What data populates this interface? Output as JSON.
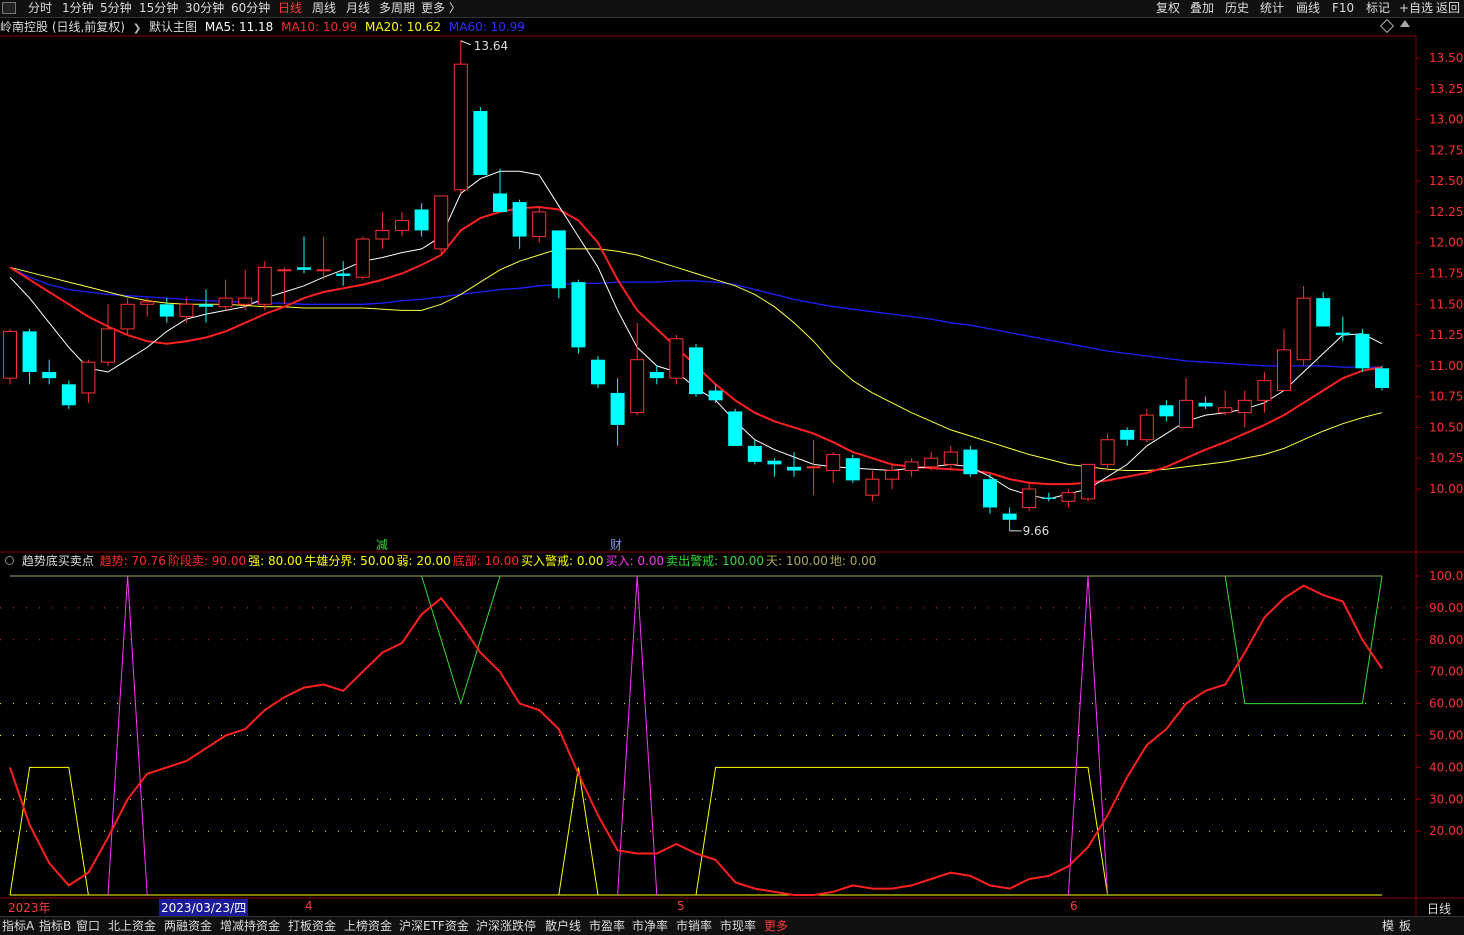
{
  "topbar": {
    "tabs": [
      {
        "label": "分时",
        "active": false
      },
      {
        "label": "1分钟",
        "active": false
      },
      {
        "label": "5分钟",
        "active": false
      },
      {
        "label": "15分钟",
        "active": false
      },
      {
        "label": "30分钟",
        "active": false
      },
      {
        "label": "60分钟",
        "active": false
      },
      {
        "label": "日线",
        "active": true
      },
      {
        "label": "周线",
        "active": false
      },
      {
        "label": "月线",
        "active": false
      },
      {
        "label": "多周期",
        "active": false
      },
      {
        "label": "更多 〉",
        "active": false
      }
    ],
    "tools": [
      "复权",
      "叠加",
      "历史",
      "统计",
      "画线",
      "F10",
      "标记",
      "+自选",
      "返回"
    ]
  },
  "main_chart": {
    "stock_title": "岭南控股 (日线,前复权)",
    "chevron": "❯",
    "template": "默认主图",
    "ma": [
      {
        "label": "MA5: 11.18",
        "color": "#ffffff"
      },
      {
        "label": "MA10: 10.99",
        "color": "#ff2a2a"
      },
      {
        "label": "MA20: 10.62",
        "color": "#ffff00"
      },
      {
        "label": "MA60: 10.99",
        "color": "#2f2fff"
      }
    ],
    "high_label": "13.64",
    "low_label": "9.66",
    "marker_1": "减",
    "marker_2": "财"
  },
  "indicator": {
    "name": "趋势底买卖点",
    "params": [
      {
        "label": "趋势: 70.76",
        "color": "#ff2a2a"
      },
      {
        "label": "阶段卖: 90.00",
        "color": "#ff2a2a"
      },
      {
        "label": "强: 80.00",
        "color": "#ffff00"
      },
      {
        "label": "牛雄分界: 50.00",
        "color": "#ffff00"
      },
      {
        "label": "弱: 20.00",
        "color": "#ffff00"
      },
      {
        "label": "底部: 10.00",
        "color": "#ff2a2a"
      },
      {
        "label": "买入警戒: 0.00",
        "color": "#ffff00"
      },
      {
        "label": "买入: 0.00",
        "color": "#ff33ff"
      },
      {
        "label": "卖出警戒: 100.00",
        "color": "#33dd33"
      },
      {
        "label": "天: 100.00",
        "color": "#aaaa55"
      },
      {
        "label": "地: 0.00",
        "color": "#aaaa55"
      }
    ]
  },
  "price_axis": [
    "13.50",
    "13.25",
    "13.00",
    "12.75",
    "12.50",
    "12.25",
    "12.00",
    "11.75",
    "11.50",
    "11.25",
    "11.00",
    "10.75",
    "10.50",
    "10.25",
    "10.00"
  ],
  "indicator_axis": [
    "100.0",
    "90.00",
    "80.00",
    "70.00",
    "60.00",
    "50.00",
    "40.00",
    "30.00",
    "20.00"
  ],
  "date_axis": {
    "year": "2023年",
    "cursor_date": "2023/03/23/四",
    "months": [
      "4",
      "5",
      "6"
    ],
    "period": "日线"
  },
  "bottombar": {
    "tabs": [
      "指标A",
      "指标B",
      "窗口",
      "北上资金",
      "两融资金",
      "增减持资金",
      "打板资金",
      "上榜资金",
      "沪深ETF资金",
      "沪深涨跌停",
      "散户线",
      "市盈率",
      "市净率",
      "市销率",
      "市现率",
      "更多"
    ],
    "right": [
      "模",
      "板"
    ]
  },
  "colors": {
    "up": "#ff3030",
    "down": "#00ffff",
    "ma5": "#ffffff",
    "ma10": "#ff2020",
    "ma20": "#ffff40",
    "ma60": "#2020ff",
    "trend": "#ff2020"
  },
  "chart_data": {
    "type": "candlestick",
    "ylim": [
      9.55,
      13.75
    ],
    "candles": [
      {
        "o": 10.9,
        "h": 11.3,
        "l": 10.85,
        "c": 11.28
      },
      {
        "o": 11.28,
        "h": 11.3,
        "l": 10.85,
        "c": 10.95
      },
      {
        "o": 10.95,
        "h": 11.05,
        "l": 10.85,
        "c": 10.9
      },
      {
        "o": 10.85,
        "h": 10.88,
        "l": 10.65,
        "c": 10.68
      },
      {
        "o": 10.78,
        "h": 11.05,
        "l": 10.7,
        "c": 11.03
      },
      {
        "o": 11.03,
        "h": 11.5,
        "l": 11.0,
        "c": 11.3
      },
      {
        "o": 11.3,
        "h": 11.55,
        "l": 11.25,
        "c": 11.5
      },
      {
        "o": 11.5,
        "h": 11.55,
        "l": 11.4,
        "c": 11.52
      },
      {
        "o": 11.5,
        "h": 11.55,
        "l": 11.35,
        "c": 11.4
      },
      {
        "o": 11.4,
        "h": 11.55,
        "l": 11.35,
        "c": 11.5
      },
      {
        "o": 11.5,
        "h": 11.62,
        "l": 11.35,
        "c": 11.48
      },
      {
        "o": 11.48,
        "h": 11.7,
        "l": 11.45,
        "c": 11.55
      },
      {
        "o": 11.5,
        "h": 11.78,
        "l": 11.45,
        "c": 11.55
      },
      {
        "o": 11.5,
        "h": 11.85,
        "l": 11.45,
        "c": 11.8
      },
      {
        "o": 11.78,
        "h": 11.8,
        "l": 11.5,
        "c": 11.78
      },
      {
        "o": 11.8,
        "h": 12.05,
        "l": 11.75,
        "c": 11.78
      },
      {
        "o": 11.78,
        "h": 12.05,
        "l": 11.7,
        "c": 11.78
      },
      {
        "o": 11.75,
        "h": 11.85,
        "l": 11.65,
        "c": 11.73
      },
      {
        "o": 11.72,
        "h": 12.05,
        "l": 11.7,
        "c": 12.03
      },
      {
        "o": 12.03,
        "h": 12.25,
        "l": 11.95,
        "c": 12.1
      },
      {
        "o": 12.1,
        "h": 12.25,
        "l": 12.05,
        "c": 12.18
      },
      {
        "o": 12.27,
        "h": 12.32,
        "l": 12.05,
        "c": 12.1
      },
      {
        "o": 11.95,
        "h": 12.3,
        "l": 11.9,
        "c": 12.38
      },
      {
        "o": 12.43,
        "h": 13.64,
        "l": 12.4,
        "c": 13.45
      },
      {
        "o": 13.07,
        "h": 13.1,
        "l": 12.55,
        "c": 12.55
      },
      {
        "o": 12.4,
        "h": 12.6,
        "l": 12.25,
        "c": 12.25
      },
      {
        "o": 12.33,
        "h": 12.35,
        "l": 11.95,
        "c": 12.05
      },
      {
        "o": 12.05,
        "h": 12.3,
        "l": 12.0,
        "c": 12.25
      },
      {
        "o": 12.1,
        "h": 12.1,
        "l": 11.55,
        "c": 11.63
      },
      {
        "o": 11.68,
        "h": 11.7,
        "l": 11.1,
        "c": 11.15
      },
      {
        "o": 11.05,
        "h": 11.08,
        "l": 10.82,
        "c": 10.85
      },
      {
        "o": 10.78,
        "h": 10.9,
        "l": 10.35,
        "c": 10.52
      },
      {
        "o": 10.62,
        "h": 11.35,
        "l": 10.6,
        "c": 11.05
      },
      {
        "o": 10.95,
        "h": 11.0,
        "l": 10.85,
        "c": 10.9
      },
      {
        "o": 10.9,
        "h": 11.25,
        "l": 10.85,
        "c": 11.22
      },
      {
        "o": 11.15,
        "h": 11.18,
        "l": 10.75,
        "c": 10.77
      },
      {
        "o": 10.8,
        "h": 10.85,
        "l": 10.7,
        "c": 10.72
      },
      {
        "o": 10.63,
        "h": 10.65,
        "l": 10.35,
        "c": 10.35
      },
      {
        "o": 10.35,
        "h": 10.4,
        "l": 10.2,
        "c": 10.22
      },
      {
        "o": 10.23,
        "h": 10.25,
        "l": 10.1,
        "c": 10.2
      },
      {
        "o": 10.18,
        "h": 10.3,
        "l": 10.1,
        "c": 10.15
      },
      {
        "o": 10.18,
        "h": 10.4,
        "l": 9.95,
        "c": 10.18
      },
      {
        "o": 10.15,
        "h": 10.3,
        "l": 10.05,
        "c": 10.28
      },
      {
        "o": 10.25,
        "h": 10.28,
        "l": 10.05,
        "c": 10.07
      },
      {
        "o": 9.95,
        "h": 10.15,
        "l": 9.9,
        "c": 10.08
      },
      {
        "o": 10.08,
        "h": 10.2,
        "l": 10.0,
        "c": 10.15
      },
      {
        "o": 10.15,
        "h": 10.25,
        "l": 10.1,
        "c": 10.22
      },
      {
        "o": 10.18,
        "h": 10.3,
        "l": 10.15,
        "c": 10.25
      },
      {
        "o": 10.2,
        "h": 10.35,
        "l": 10.15,
        "c": 10.3
      },
      {
        "o": 10.32,
        "h": 10.35,
        "l": 10.1,
        "c": 10.12
      },
      {
        "o": 10.08,
        "h": 10.12,
        "l": 9.8,
        "c": 9.85
      },
      {
        "o": 9.8,
        "h": 9.85,
        "l": 9.66,
        "c": 9.75
      },
      {
        "o": 9.85,
        "h": 10.05,
        "l": 9.82,
        "c": 10.0
      },
      {
        "o": 9.93,
        "h": 9.97,
        "l": 9.9,
        "c": 9.92
      },
      {
        "o": 9.9,
        "h": 10.0,
        "l": 9.85,
        "c": 9.97
      },
      {
        "o": 9.92,
        "h": 10.2,
        "l": 9.9,
        "c": 10.2
      },
      {
        "o": 10.2,
        "h": 10.45,
        "l": 10.15,
        "c": 10.4
      },
      {
        "o": 10.48,
        "h": 10.5,
        "l": 10.35,
        "c": 10.4
      },
      {
        "o": 10.4,
        "h": 10.65,
        "l": 10.38,
        "c": 10.6
      },
      {
        "o": 10.68,
        "h": 10.72,
        "l": 10.55,
        "c": 10.59
      },
      {
        "o": 10.5,
        "h": 10.9,
        "l": 10.5,
        "c": 10.72
      },
      {
        "o": 10.7,
        "h": 10.75,
        "l": 10.65,
        "c": 10.67
      },
      {
        "o": 10.62,
        "h": 10.8,
        "l": 10.6,
        "c": 10.66
      },
      {
        "o": 10.62,
        "h": 10.8,
        "l": 10.5,
        "c": 10.72
      },
      {
        "o": 10.72,
        "h": 10.95,
        "l": 10.62,
        "c": 10.88
      },
      {
        "o": 10.8,
        "h": 11.3,
        "l": 10.8,
        "c": 11.13
      },
      {
        "o": 11.05,
        "h": 11.65,
        "l": 11.0,
        "c": 11.55
      },
      {
        "o": 11.55,
        "h": 11.6,
        "l": 11.35,
        "c": 11.32
      },
      {
        "o": 11.27,
        "h": 11.4,
        "l": 11.2,
        "c": 11.25
      },
      {
        "o": 11.26,
        "h": 11.3,
        "l": 10.95,
        "c": 10.98
      },
      {
        "o": 10.98,
        "h": 11.0,
        "l": 10.8,
        "c": 10.82
      }
    ],
    "ma5": [
      11.72,
      11.55,
      11.35,
      11.15,
      10.98,
      10.95,
      11.05,
      11.15,
      11.28,
      11.38,
      11.42,
      11.45,
      11.48,
      11.55,
      11.6,
      11.65,
      11.72,
      11.78,
      11.85,
      11.88,
      11.92,
      11.95,
      12.05,
      12.4,
      12.52,
      12.58,
      12.58,
      12.55,
      12.3,
      12.05,
      11.8,
      11.45,
      11.15,
      11.0,
      10.95,
      10.82,
      10.72,
      10.55,
      10.4,
      10.32,
      10.26,
      10.2,
      10.18,
      10.17,
      10.16,
      10.15,
      10.17,
      10.18,
      10.2,
      10.18,
      10.1,
      10.0,
      9.95,
      9.92,
      9.96,
      10.0,
      10.1,
      10.2,
      10.35,
      10.45,
      10.55,
      10.6,
      10.62,
      10.65,
      10.7,
      10.8,
      10.95,
      11.1,
      11.25,
      11.26,
      11.18
    ],
    "ma10": [
      11.8,
      11.7,
      11.6,
      11.5,
      11.4,
      11.32,
      11.25,
      11.2,
      11.18,
      11.2,
      11.23,
      11.28,
      11.35,
      11.42,
      11.48,
      11.55,
      11.6,
      11.63,
      11.66,
      11.7,
      11.75,
      11.82,
      11.9,
      12.1,
      12.2,
      12.25,
      12.28,
      12.29,
      12.27,
      12.18,
      12.0,
      11.7,
      11.45,
      11.3,
      11.15,
      11.0,
      10.85,
      10.72,
      10.62,
      10.55,
      10.5,
      10.45,
      10.38,
      10.3,
      10.25,
      10.2,
      10.18,
      10.17,
      10.16,
      10.15,
      10.13,
      10.08,
      10.05,
      10.04,
      10.04,
      10.05,
      10.07,
      10.1,
      10.13,
      10.18,
      10.25,
      10.32,
      10.38,
      10.45,
      10.52,
      10.6,
      10.7,
      10.8,
      10.9,
      10.96,
      10.99
    ],
    "ma20": [
      11.8,
      11.76,
      11.72,
      11.68,
      11.64,
      11.6,
      11.56,
      11.53,
      11.51,
      11.5,
      11.5,
      11.5,
      11.49,
      11.48,
      11.48,
      11.47,
      11.47,
      11.47,
      11.47,
      11.46,
      11.45,
      11.45,
      11.5,
      11.58,
      11.68,
      11.78,
      11.85,
      11.9,
      11.95,
      11.95,
      11.95,
      11.93,
      11.9,
      11.85,
      11.8,
      11.75,
      11.7,
      11.65,
      11.58,
      11.48,
      11.35,
      11.2,
      11.02,
      10.88,
      10.78,
      10.7,
      10.62,
      10.55,
      10.48,
      10.43,
      10.38,
      10.33,
      10.28,
      10.24,
      10.2,
      10.18,
      10.16,
      10.15,
      10.15,
      10.16,
      10.18,
      10.2,
      10.22,
      10.25,
      10.28,
      10.33,
      10.4,
      10.47,
      10.53,
      10.58,
      10.62
    ],
    "ma60": [
      11.8,
      11.72,
      11.66,
      11.62,
      11.6,
      11.58,
      11.57,
      11.56,
      11.55,
      11.54,
      11.53,
      11.52,
      11.52,
      11.51,
      11.51,
      11.5,
      11.5,
      11.5,
      11.5,
      11.51,
      11.53,
      11.54,
      11.56,
      11.58,
      11.6,
      11.62,
      11.63,
      11.65,
      11.66,
      11.67,
      11.67,
      11.68,
      11.68,
      11.68,
      11.69,
      11.69,
      11.68,
      11.66,
      11.62,
      11.58,
      11.54,
      11.51,
      11.48,
      11.46,
      11.44,
      11.42,
      11.4,
      11.38,
      11.35,
      11.33,
      11.3,
      11.27,
      11.24,
      11.21,
      11.18,
      11.15,
      11.12,
      11.1,
      11.08,
      11.06,
      11.04,
      11.03,
      11.02,
      11.01,
      11.0,
      11.0,
      11.0,
      11.0,
      10.99,
      10.99,
      10.99
    ],
    "indicator": {
      "ylim": [
        0,
        100
      ],
      "trend": [
        40,
        22,
        10,
        3,
        7,
        18,
        30,
        38,
        40,
        42,
        46,
        50,
        52,
        58,
        62,
        65,
        66,
        64,
        70,
        76,
        79,
        88,
        93,
        85,
        76,
        70,
        60,
        58,
        52,
        38,
        25,
        14,
        13,
        13,
        16,
        13,
        11,
        4,
        2,
        1,
        0,
        0,
        1,
        3,
        2,
        2,
        3,
        5,
        7,
        6,
        3,
        2,
        5,
        6,
        9,
        15,
        25,
        37,
        47,
        52,
        60,
        64,
        66,
        76,
        87,
        93,
        97,
        94,
        92,
        80,
        71
      ],
      "yellow": [
        0,
        40,
        40,
        40,
        0,
        0,
        0,
        0,
        0,
        0,
        0,
        0,
        0,
        0,
        0,
        0,
        0,
        0,
        0,
        0,
        0,
        0,
        0,
        0,
        0,
        0,
        0,
        0,
        0,
        40,
        0,
        0,
        0,
        0,
        0,
        0,
        40,
        40,
        40,
        40,
        40,
        40,
        40,
        40,
        40,
        40,
        40,
        40,
        40,
        40,
        40,
        40,
        40,
        40,
        40,
        40,
        0,
        0,
        0,
        0,
        0,
        0,
        0,
        0,
        0,
        0,
        0,
        0,
        0,
        0,
        0
      ],
      "magenta_spikes": [
        6,
        32,
        55
      ],
      "green_dips": [
        [
          22,
          23,
          24
        ],
        [
          63,
          64,
          65,
          66,
          67,
          68,
          69
        ]
      ]
    }
  }
}
